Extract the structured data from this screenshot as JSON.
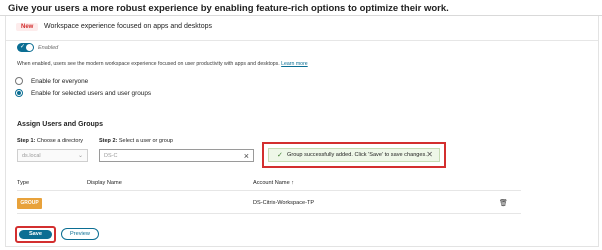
{
  "header": {
    "text": "Give your users a more robust experience by enabling feature-rich options to optimize their work."
  },
  "card": {
    "badge": "New",
    "title": "Workspace experience focused on apps and desktops",
    "toggle": {
      "state": "on",
      "label": "Enabled"
    },
    "description": "When enabled, users see the modern workspace experience focused on user productivity with apps and desktops.",
    "learn_more": "Learn more",
    "radios": [
      {
        "label": "Enable for everyone",
        "selected": false
      },
      {
        "label": "Enable for selected users and user groups",
        "selected": true
      }
    ]
  },
  "assign": {
    "title": "Assign Users and Groups",
    "step1": {
      "prefix": "Step 1:",
      "text": "Choose a directory",
      "value": "ds.local"
    },
    "step2": {
      "prefix": "Step 2:",
      "text": "Select a user or group",
      "value": "DS-C"
    },
    "toast": "Group successfully added. Click 'Save' to save changes."
  },
  "table": {
    "headers": {
      "type": "Type",
      "display_name": "Display Name",
      "account_name": "Account Name",
      "sort_icon": "arrow-up-icon"
    },
    "rows": [
      {
        "type": "GROUP",
        "display_name": "",
        "account_name": "DS-Citrix-Workspace-TP"
      }
    ]
  },
  "actions": {
    "save": "Save",
    "preview": "Preview"
  },
  "colors": {
    "accent": "#0b6e93",
    "badge_group": "#e8a23b",
    "highlight": "#d32f2f",
    "toast_bg": "#eef7e8"
  }
}
